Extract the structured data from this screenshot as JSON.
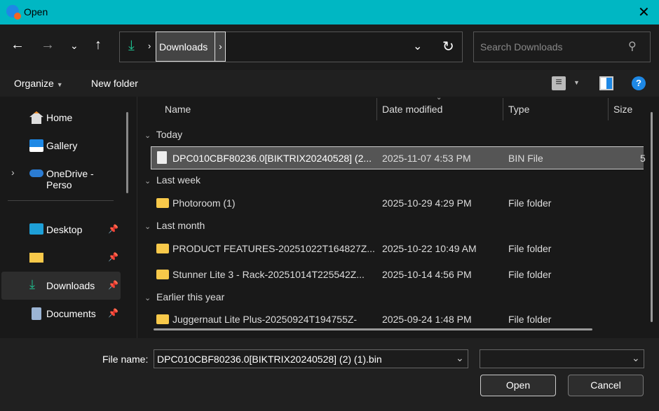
{
  "window": {
    "title": "Open"
  },
  "address": {
    "crumb": "Downloads",
    "search_placeholder": "Search Downloads"
  },
  "toolbar": {
    "organize": "Organize",
    "new_folder": "New folder"
  },
  "sidebar": {
    "items": [
      {
        "label": "Home"
      },
      {
        "label": "Gallery"
      },
      {
        "label": "OneDrive - Perso"
      },
      {
        "label": "Desktop"
      },
      {
        "label": ""
      },
      {
        "label": "Downloads"
      },
      {
        "label": "Documents"
      }
    ]
  },
  "columns": [
    "Name",
    "Date modified",
    "Type",
    "Size"
  ],
  "groups": [
    {
      "label": "Today"
    },
    {
      "label": "Last week"
    },
    {
      "label": "Last month"
    },
    {
      "label": "Earlier this year"
    }
  ],
  "rows": [
    {
      "name": "DPC010CBF80236.0[BIKTRIX20240528] (2...",
      "date": "2025-11-07 4:53 PM",
      "type": "BIN File",
      "size": "5"
    },
    {
      "name": "Photoroom (1)",
      "date": "2025-10-29 4:29 PM",
      "type": "File folder",
      "size": ""
    },
    {
      "name": "PRODUCT FEATURES-20251022T164827Z...",
      "date": "2025-10-22 10:49 AM",
      "type": "File folder",
      "size": ""
    },
    {
      "name": "Stunner Lite 3 - Rack-20251014T225542Z...",
      "date": "2025-10-14 4:56 PM",
      "type": "File folder",
      "size": ""
    },
    {
      "name": "Juggernaut Lite Plus-20250924T194755Z-",
      "date": "2025-09-24 1:48 PM",
      "type": "File folder",
      "size": ""
    }
  ],
  "footer": {
    "file_name_label": "File name:",
    "file_name_value": "DPC010CBF80236.0[BIKTRIX20240528] (2) (1).bin",
    "filter_value": "",
    "open": "Open",
    "cancel": "Cancel"
  }
}
